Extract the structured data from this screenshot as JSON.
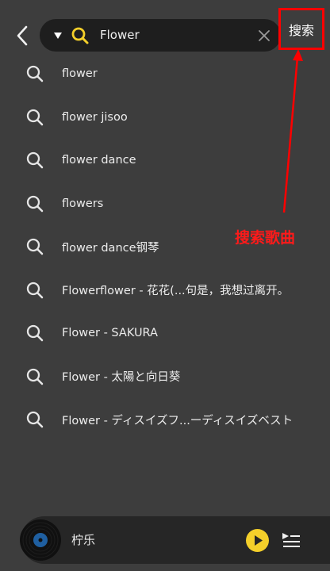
{
  "header": {
    "back_icon": "chevron-left-icon",
    "search_query": "Flower",
    "search_button_label": "搜索",
    "accent_color": "#f4cf2a"
  },
  "annotation": {
    "label": "搜索歌曲",
    "color": "#ff0000"
  },
  "suggestions": [
    {
      "text": "flower"
    },
    {
      "text": "flower jisoo"
    },
    {
      "text": "flower dance"
    },
    {
      "text": "flowers"
    },
    {
      "text": "flower dance钢琴"
    },
    {
      "text": "Flowerflower - 花花(...句是，我想过离开。"
    },
    {
      "text": "Flower - SAKURA"
    },
    {
      "text": "Flower - 太陽と向日葵"
    },
    {
      "text": "Flower - ディスイズフ...ーディスイズベスト"
    }
  ],
  "player": {
    "title": "柠乐",
    "play_color": "#f4cf2a"
  }
}
